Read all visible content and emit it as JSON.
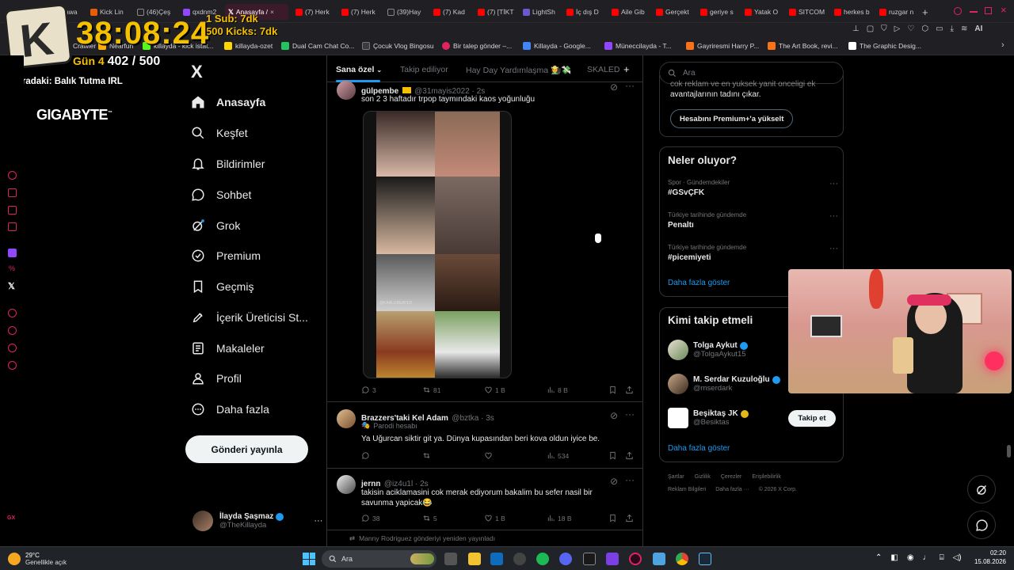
{
  "browser": {
    "tabs": [
      "awa",
      "Kick Lin",
      "(46)Çeş",
      "qxdnm2",
      "Anasayfa /",
      "(7) Herk",
      "(7) Herk",
      "(39)Hay",
      "(7) Kad",
      "(7) [TİKT",
      "LightSh",
      "İç dış D",
      "Aile Gib",
      "Gerçekt",
      "geriye s",
      "Yatak O",
      "SITCOM",
      "herkes b",
      "ruzgar n"
    ],
    "active_tab": "Anasayfa /",
    "new_tab": "+",
    "bookmarks": [
      "Link Crawler",
      "Nearfun",
      "killayda - kick istat...",
      "killayda-ozet",
      "Dual Cam Chat Co...",
      "Çocuk Vlog Bingosu",
      "Bir talep gönder –...",
      "Killayda - Google...",
      "Müneccilayda - T...",
      "Gayriresmi Harry P...",
      "The Art Book, revi...",
      "The Graphic Desig..."
    ],
    "ai_label": "AI",
    "colors": {
      "tabbar": "#1f1f24",
      "active_tab": "#3b1a2a"
    }
  },
  "overlay": {
    "timer": "38:08:24",
    "subs": "1 Sub: 7dk",
    "kicks": "500 Kicks: 7dk",
    "day": "Gün 4",
    "progress": "402 / 500",
    "next_label": "Sıradaki: Balık Tutma IRL",
    "sponsor": "GIGABYTE",
    "sponsor_tm": "™"
  },
  "left_strip": {
    "icons": [
      "circle-icon",
      "alert-icon",
      "grid-icon",
      "stop-icon",
      "twitch-icon",
      "percent-icon",
      "x-icon",
      "record-icon",
      "clock-icon",
      "power-icon",
      "gear-icon"
    ],
    "bottom_label": "GX"
  },
  "nav": {
    "logo": "X",
    "items": [
      {
        "label": "Anasayfa",
        "icon": "home-icon",
        "active": true
      },
      {
        "label": "Keşfet",
        "icon": "search-icon"
      },
      {
        "label": "Bildirimler",
        "icon": "bell-icon"
      },
      {
        "label": "Sohbet",
        "icon": "chat-icon"
      },
      {
        "label": "Grok",
        "icon": "grok-icon"
      },
      {
        "label": "Premium",
        "icon": "premium-icon"
      },
      {
        "label": "Geçmiş",
        "icon": "bookmark-icon"
      },
      {
        "label": "İçerik Üreticisi St...",
        "icon": "rocket-icon"
      },
      {
        "label": "Makaleler",
        "icon": "article-icon"
      },
      {
        "label": "Profil",
        "icon": "profile-icon"
      },
      {
        "label": "Daha fazla",
        "icon": "more-icon"
      }
    ],
    "post_button": "Gönderi yayınla",
    "profile_name": "İlayda Şaşmaz",
    "profile_handle": "@TheKillayda",
    "profile_more": "···"
  },
  "timeline": {
    "tabs": [
      "Sana özel",
      "Takip ediliyor",
      "Hay Day Yardımlaşma 👩‍🌾💸",
      "SKALED"
    ],
    "add_tab": "+",
    "tweets": [
      {
        "name": "gülpembe",
        "handle": "@31mayis2022 · 2s",
        "text": "son 2 3 haftadır trpop taymındaki kaos yoğunluğu",
        "image_watermark": "@KAALCREATED",
        "replies": "3",
        "retweets": "81",
        "likes": "1 B",
        "views": "8 B"
      },
      {
        "name": "Brazzers'taki Kel Adam",
        "handle": "@bztka · 3s",
        "badge": "Parodi hesabı",
        "text": "Ya Uğurcan siktir git ya. Dünya kupasından beri kova oldun iyice be.",
        "replies": "",
        "retweets": "",
        "likes": "",
        "views": "534"
      },
      {
        "name": "jernn",
        "handle": "@iz4u1l · 2s",
        "text_line1": "takisin aciklamasini cok merak ediyorum bakalim bu sefer nasil bir",
        "text_line2": "savunma yapicak😂",
        "replies": "38",
        "retweets": "5",
        "likes": "1 B",
        "views": "18 B"
      }
    ],
    "repost_note": "Manny Rodriguez gönderiyi yeniden yayınladı"
  },
  "right": {
    "search_placeholder": "Ara",
    "premium_text1": "cok reklam ve en yuksek yanit onceligi ek",
    "premium_text2": "avantajlarının tadını çıkar.",
    "premium_button": "Hesabını Premium+'a yükselt",
    "trends_title": "Neler oluyor?",
    "trends": [
      {
        "context": "Spor · Gündemdekiler",
        "topic": "#GSvÇFK"
      },
      {
        "context": "Türkiye tarihinde gündemde",
        "topic": "Penaltı"
      },
      {
        "context": "Türkiye tarihinde gündemde",
        "topic": "#picemiyeti"
      }
    ],
    "show_more": "Daha fazla göster",
    "follow_title": "Kimi takip etmeli",
    "follow": [
      {
        "name": "Tolga Aykut",
        "handle": "@TolgaAykut15"
      },
      {
        "name": "M. Serdar Kuzuloğlu",
        "handle": "@mserdark"
      },
      {
        "name": "Beşiktaş JK",
        "handle": "@Besiktas",
        "button": "Takip et"
      }
    ],
    "follow_more": "Daha fazla göster",
    "footer1": [
      "Şartlar",
      "Gizlilik",
      "Çerezler",
      "Erişilebilirlik"
    ],
    "footer2": [
      "Reklam Bilgileri",
      "Daha fazla ···",
      "© 2026 X Corp."
    ]
  },
  "taskbar": {
    "weather_temp": "29°C",
    "weather_desc": "Genellikle açık",
    "search_placeholder": "Ara",
    "time": "02:20",
    "date": "15.08.2026"
  }
}
